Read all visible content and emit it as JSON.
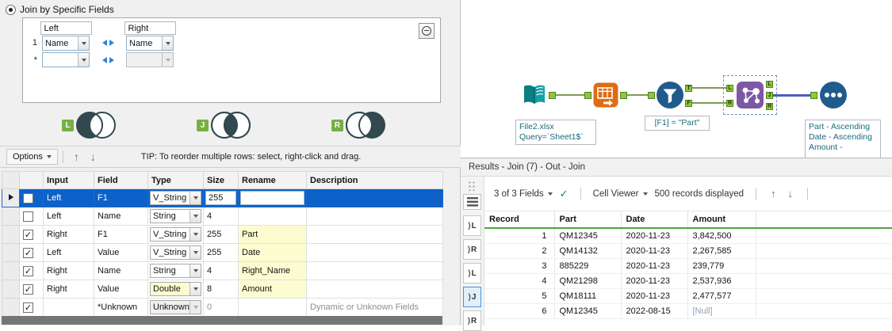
{
  "colors": {
    "selection_blue": "#0d61c9",
    "highlight_yellow": "#fcfcd1",
    "anchor_green": "#8dc63f",
    "badge_green": "#76b043",
    "wire_green": "#7e9b55",
    "wire_blue": "#4b5cc4",
    "venn_dark": "#31494f",
    "join_purple": "#7d58a5",
    "annotation_teal": "#1a6b7d",
    "header_underline_green": "#4aa53c"
  },
  "icons": {
    "check": "✓",
    "up_arrow": "↑",
    "down_arrow": "↓",
    "anchor_bracket": ")"
  },
  "join_config": {
    "title": "Join by Specific Fields",
    "grid": {
      "headers": {
        "left": "Left",
        "right": "Right"
      },
      "rows": [
        {
          "num": "1",
          "left": "Name",
          "right": "Name"
        },
        {
          "num": "*",
          "left": "",
          "right": ""
        }
      ]
    },
    "venns": [
      {
        "label": "L"
      },
      {
        "label": "J"
      },
      {
        "label": "R"
      }
    ],
    "options_label": "Options",
    "tip": "TIP: To reorder multiple rows: select, right-click and drag."
  },
  "fields_table": {
    "headers": [
      "Input",
      "Field",
      "Type",
      "Size",
      "Rename",
      "Description"
    ],
    "rows": [
      {
        "checked": false,
        "selected": true,
        "input": "Left",
        "field": "F1",
        "type": "V_String",
        "size": "255",
        "rename": "",
        "description": ""
      },
      {
        "checked": false,
        "selected": false,
        "input": "Left",
        "field": "Name",
        "type": "String",
        "size": "4",
        "rename": "",
        "description": ""
      },
      {
        "checked": true,
        "selected": false,
        "input": "Right",
        "field": "F1",
        "type": "V_String",
        "size": "255",
        "rename": "Part",
        "description": ""
      },
      {
        "checked": true,
        "selected": false,
        "input": "Left",
        "field": "Value",
        "type": "V_String",
        "size": "255",
        "rename": "Date",
        "description": ""
      },
      {
        "checked": true,
        "selected": false,
        "input": "Right",
        "field": "Name",
        "type": "String",
        "size": "4",
        "rename": "Right_Name",
        "description": ""
      },
      {
        "checked": true,
        "selected": false,
        "input": "Right",
        "field": "Value",
        "type": "Double",
        "size": "8",
        "rename": "Amount",
        "description": ""
      },
      {
        "checked": true,
        "selected": false,
        "input": "",
        "field": "*Unknown",
        "type": "Unknown",
        "size": "0",
        "rename": "",
        "description": "Dynamic or Unknown Fields"
      }
    ]
  },
  "canvas": {
    "input_annotation_line1": "File2.xlsx",
    "input_annotation_line2": "Query=`Sheet1$`",
    "filter_annotation": "[F1] = \"Part\"",
    "sort_annotation_line1": "Part - Ascending",
    "sort_annotation_line2": "Date - Ascending",
    "sort_annotation_line3": "Amount -",
    "filter_anchors": {
      "true": "T",
      "false": "F"
    },
    "join_anchors": {
      "in_left": "L",
      "in_right": "R",
      "out_left": "L",
      "out_join": "J",
      "out_right": "R"
    }
  },
  "results": {
    "title": "Results - Join (7) - Out - Join",
    "toolbar": {
      "fields_dropdown": "3 of 3 Fields",
      "cell_viewer": "Cell Viewer",
      "records_text": "500 records displayed"
    },
    "anchors": [
      "L",
      "R",
      "L",
      "J",
      "R"
    ],
    "grid": {
      "headers": [
        "Record",
        "Part",
        "Date",
        "Amount"
      ],
      "rows": [
        {
          "record": "1",
          "part": "QM12345",
          "date": "2020-11-23",
          "amount": "3,842,500"
        },
        {
          "record": "2",
          "part": "QM14132",
          "date": "2020-11-23",
          "amount": "2,267,585"
        },
        {
          "record": "3",
          "part": "885229",
          "date": "2020-11-23",
          "amount": "239,779"
        },
        {
          "record": "4",
          "part": "QM21298",
          "date": "2020-11-23",
          "amount": "2,537,936"
        },
        {
          "record": "5",
          "part": "QM18111",
          "date": "2020-11-23",
          "amount": "2,477,577"
        },
        {
          "record": "6",
          "part": "QM12345",
          "date": "2022-08-15",
          "amount": "[Null]"
        }
      ]
    }
  }
}
